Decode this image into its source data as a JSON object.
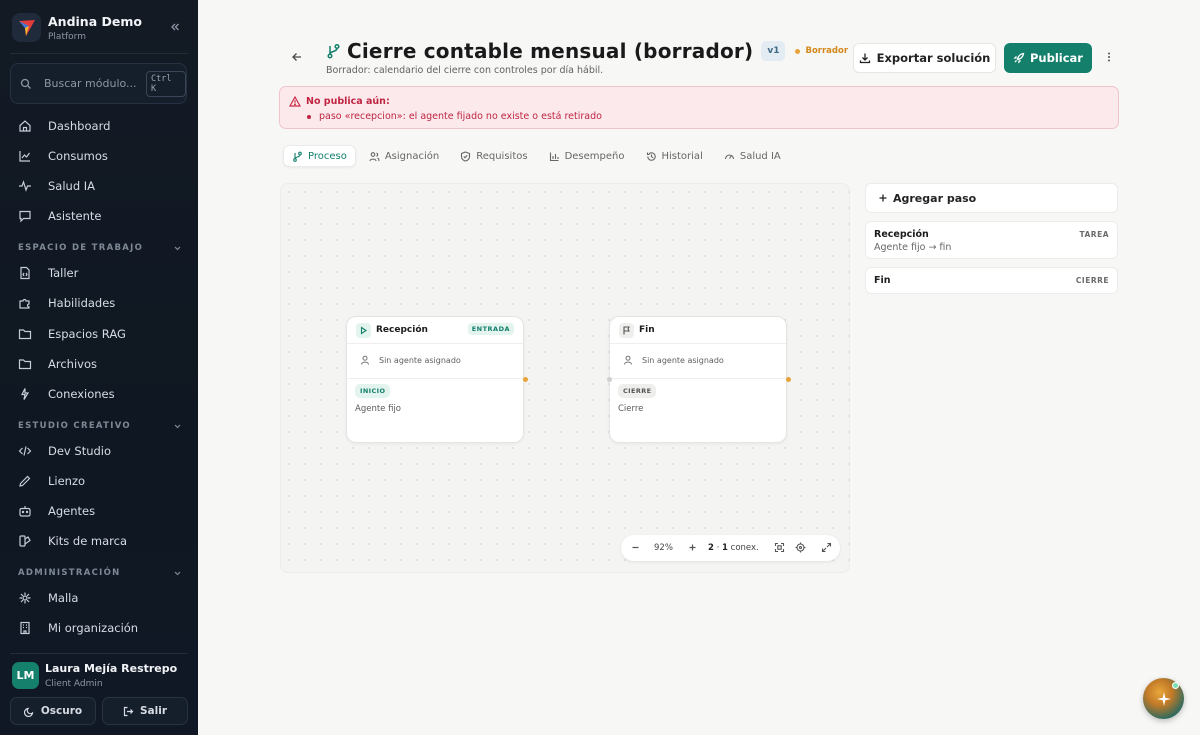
{
  "sidebar": {
    "brand_name": "Andina Demo",
    "brand_sub": "Platform",
    "search_placeholder": "Buscar módulo...",
    "search_shortcut": "Ctrl K",
    "items_top": [
      {
        "label": "Dashboard",
        "icon": "home-icon"
      },
      {
        "label": "Consumos",
        "icon": "chart-line-icon"
      },
      {
        "label": "Salud IA",
        "icon": "pulse-icon"
      },
      {
        "label": "Asistente",
        "icon": "chat-icon"
      }
    ],
    "section_workspace": "ESPACIO DE TRABAJO",
    "items_workspace": [
      {
        "label": "Taller",
        "icon": "file-code-icon"
      },
      {
        "label": "Habilidades",
        "icon": "puzzle-icon"
      },
      {
        "label": "Espacios RAG",
        "icon": "folder-icon"
      },
      {
        "label": "Archivos",
        "icon": "folder-icon"
      },
      {
        "label": "Conexiones",
        "icon": "plug-icon"
      }
    ],
    "section_studio": "ESTUDIO CREATIVO",
    "items_studio": [
      {
        "label": "Dev Studio",
        "icon": "code-icon"
      },
      {
        "label": "Lienzo",
        "icon": "pencil-icon"
      },
      {
        "label": "Agentes",
        "icon": "bot-icon"
      },
      {
        "label": "Kits de marca",
        "icon": "palette-icon"
      }
    ],
    "section_admin": "ADMINISTRACIÓN",
    "items_admin": [
      {
        "label": "Malla",
        "icon": "network-icon"
      },
      {
        "label": "Mi organización",
        "icon": "building-icon"
      }
    ],
    "user_initials": "LM",
    "user_name": "Laura Mejía Restrepo",
    "user_role": "Client Admin",
    "theme_button": "Oscuro",
    "logout_button": "Salir"
  },
  "header": {
    "title": "Cierre contable mensual (borrador)",
    "version": "v1",
    "status": "Borrador",
    "subtitle": "Borrador: calendario del cierre con controles por día hábil.",
    "export_button": "Exportar solución",
    "publish_button": "Publicar"
  },
  "alert": {
    "title": "No publica aún:",
    "items": [
      "paso «recepcion»: el agente fijado no existe o está retirado"
    ]
  },
  "tabs": [
    {
      "label": "Proceso",
      "icon": "branch-icon",
      "active": true
    },
    {
      "label": "Asignación",
      "icon": "users-icon",
      "active": false
    },
    {
      "label": "Requisitos",
      "icon": "shield-check-icon",
      "active": false
    },
    {
      "label": "Desempeño",
      "icon": "bar-chart-icon",
      "active": false
    },
    {
      "label": "Historial",
      "icon": "history-icon",
      "active": false
    },
    {
      "label": "Salud IA",
      "icon": "gauge-icon",
      "active": false
    }
  ],
  "canvas": {
    "nodes": [
      {
        "title": "Recepción",
        "tag": "ENTRADA",
        "agent": "Sin agente asignado",
        "badge": "INICIO",
        "kind": "Agente fijo"
      },
      {
        "title": "Fin",
        "tag": "",
        "agent": "Sin agente asignado",
        "badge": "CIERRE",
        "kind": "Cierre"
      }
    ],
    "zoom": "92%",
    "nodes_count": "2",
    "connections_count": "1",
    "connections_label": "conex."
  },
  "steps_panel": {
    "add_button": "Agregar paso",
    "steps": [
      {
        "name": "Recepción",
        "kind": "TAREA",
        "desc": "Agente fijo → fin"
      },
      {
        "name": "Fin",
        "kind": "CIERRE",
        "desc": ""
      }
    ]
  },
  "colors": {
    "accent": "#14806b",
    "sidebar_bg": "#111925",
    "alert_text": "#c02642",
    "warning": "#e8a33a"
  }
}
